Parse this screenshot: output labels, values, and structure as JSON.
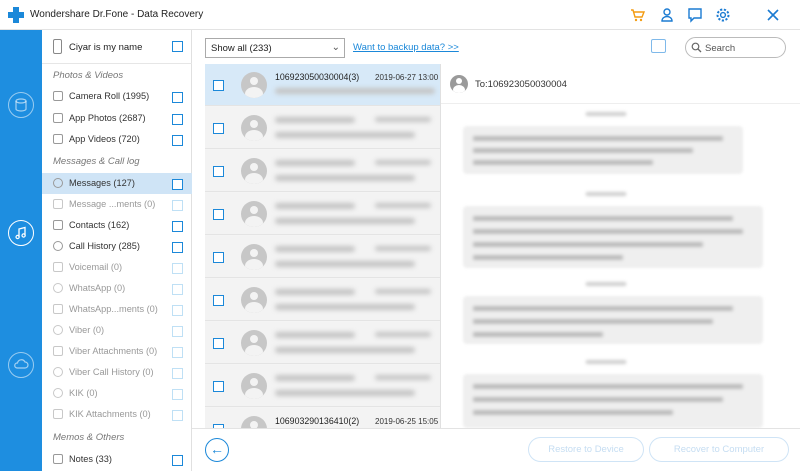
{
  "window": {
    "title": "Wondershare Dr.Fone - Data Recovery",
    "toolbar_icons": [
      "cart-icon",
      "user-icon",
      "feedback-icon",
      "settings-icon",
      "close-icon"
    ]
  },
  "device": {
    "name": "Ciyar is my name"
  },
  "sections": {
    "photos": "Photos & Videos",
    "messages": "Messages & Call log",
    "memos": "Memos & Others"
  },
  "categories": [
    {
      "label": "Camera Roll (1995)"
    },
    {
      "label": "App Photos (2687)"
    },
    {
      "label": "App Videos (720)"
    },
    {
      "label": "Messages (127)"
    },
    {
      "label": "Message ...ments (0)"
    },
    {
      "label": "Contacts (162)"
    },
    {
      "label": "Call History (285)"
    },
    {
      "label": "Voicemail (0)"
    },
    {
      "label": "WhatsApp (0)"
    },
    {
      "label": "WhatsApp...ments (0)"
    },
    {
      "label": "Viber (0)"
    },
    {
      "label": "Viber Attachments (0)"
    },
    {
      "label": "Viber Call History (0)"
    },
    {
      "label": "KIK (0)"
    },
    {
      "label": "KIK Attachments (0)"
    },
    {
      "label": "Notes (33)"
    }
  ],
  "toolbar": {
    "filter_value": "Show all (233)",
    "backup_link": "Want to backup data? >>",
    "search_placeholder": "Search"
  },
  "messages": [
    {
      "number": "106923050030004(3)",
      "date": "2019-06-27 13:00"
    },
    {
      "number": "106903290136410(2)",
      "date": "2019-06-25 15:05"
    }
  ],
  "detail": {
    "to": "To:106923050030004"
  },
  "footer": {
    "restore_label": "Restore to Device",
    "recover_label": "Recover to Computer"
  },
  "colors": {
    "accent": "#1b88d9",
    "sidebar": "#1e8ee0",
    "selected_row": "#cfe4f6"
  }
}
